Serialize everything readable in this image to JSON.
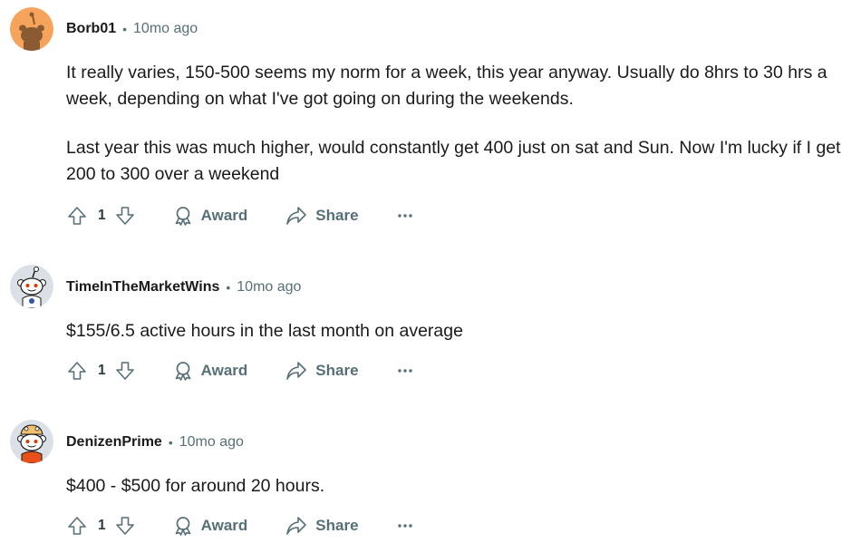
{
  "comments": [
    {
      "username": "Borb01",
      "separator": "•",
      "time": "10mo ago",
      "avatar": "orange-snoo-avatar-icon",
      "paragraphs": [
        "It really varies, 150-500 seems my norm for a week, this year anyway. Usually do 8hrs to 30 hrs a week, depending on what I've got going on during the weekends.",
        "Last year this was much higher, would constantly get 400 just on sat and Sun. Now I'm lucky if I get 200 to 300 over a weekend"
      ],
      "score": "1",
      "award_label": "Award",
      "share_label": "Share"
    },
    {
      "username": "TimeInTheMarketWins",
      "separator": "•",
      "time": "10mo ago",
      "avatar": "white-snoo-avatar-icon",
      "paragraphs": [
        "$155/6.5 active hours in the last month on average"
      ],
      "score": "1",
      "award_label": "Award",
      "share_label": "Share"
    },
    {
      "username": "DenizenPrime",
      "separator": "•",
      "time": "10mo ago",
      "avatar": "snoo-with-hat-avatar-icon",
      "paragraphs": [
        "$400 - $500 for around 20 hours."
      ],
      "score": "1",
      "award_label": "Award",
      "share_label": "Share"
    }
  ],
  "colors": {
    "text": "#1a1a1b",
    "meta": "#576f76",
    "avatar_orange": "#f6a35c",
    "avatar_grey": "#dae0e6"
  }
}
